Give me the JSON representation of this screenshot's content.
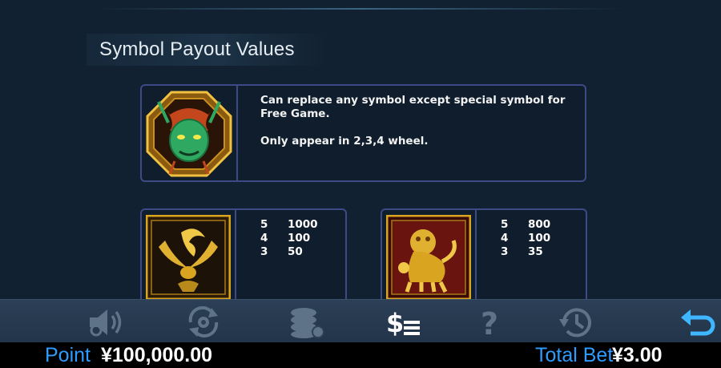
{
  "section": {
    "title": "Symbol Payout Values"
  },
  "wild": {
    "icon": "dragon-wild-icon",
    "line1": "Can replace any symbol except special symbol for Free Game.",
    "line2": "Only appear in 2,3,4 wheel."
  },
  "symbols": [
    {
      "icon": "golden-phoenix-icon",
      "pays": [
        {
          "count": "5",
          "value": "1000"
        },
        {
          "count": "4",
          "value": "100"
        },
        {
          "count": "3",
          "value": "50"
        }
      ]
    },
    {
      "icon": "golden-lion-icon",
      "pays": [
        {
          "count": "5",
          "value": "800"
        },
        {
          "count": "4",
          "value": "100"
        },
        {
          "count": "3",
          "value": "35"
        }
      ]
    }
  ],
  "toolbar": {
    "buttons": [
      "sound-icon",
      "autoplay-icon",
      "chips-icon",
      "paytable-icon",
      "help-icon",
      "history-icon",
      "back-icon"
    ]
  },
  "status": {
    "point_label": "Point",
    "point_value": "¥100,000.00",
    "bet_label": "Total Bet",
    "bet_value": "¥3.00"
  },
  "colors": {
    "accent": "#2e9cff",
    "card_border": "#3e4a86",
    "gold": "#d9a520"
  }
}
